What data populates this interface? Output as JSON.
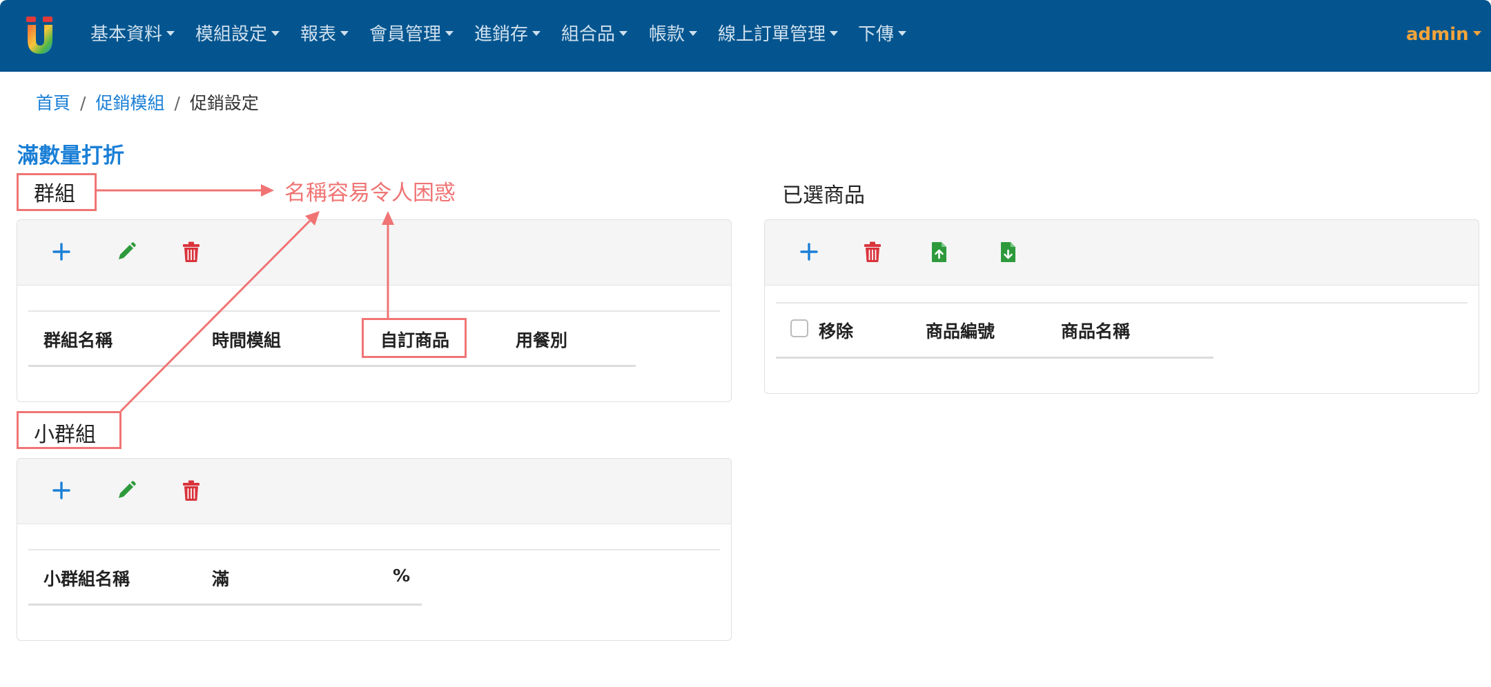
{
  "navbar": {
    "menu": [
      "基本資料",
      "模組設定",
      "報表",
      "會員管理",
      "進銷存",
      "組合品",
      "帳款",
      "線上訂單管理",
      "下傳"
    ],
    "user": "admin",
    "colors": {
      "background": "#04558f",
      "menu_text": "#cfe0ee",
      "user": "#f5a43a"
    }
  },
  "breadcrumb": {
    "items": [
      "首頁",
      "促銷模組"
    ],
    "current": "促銷設定",
    "separator": "/"
  },
  "page_title": "滿數量打折",
  "group_panel": {
    "title": "群組",
    "columns": [
      "群組名稱",
      "時間模組",
      "自訂商品",
      "用餐別"
    ]
  },
  "subgroup_panel": {
    "title": "小群組",
    "columns": [
      "小群組名稱",
      "滿",
      "%"
    ]
  },
  "selected_panel": {
    "title": "已選商品",
    "columns": [
      "移除",
      "商品編號",
      "商品名稱"
    ]
  },
  "toolbar_icons": {
    "add": "plus-icon",
    "edit": "pencil-icon",
    "delete": "trash-icon",
    "upload": "file-upload-icon",
    "download": "file-download-icon"
  },
  "annotation": {
    "text": "名稱容易令人困惑",
    "color": "#f07474"
  },
  "colors": {
    "link": "#1a7fd6",
    "add": "#1a7fd6",
    "edit": "#2e9a3c",
    "delete": "#d9343c",
    "file": "#2e9a3c"
  }
}
